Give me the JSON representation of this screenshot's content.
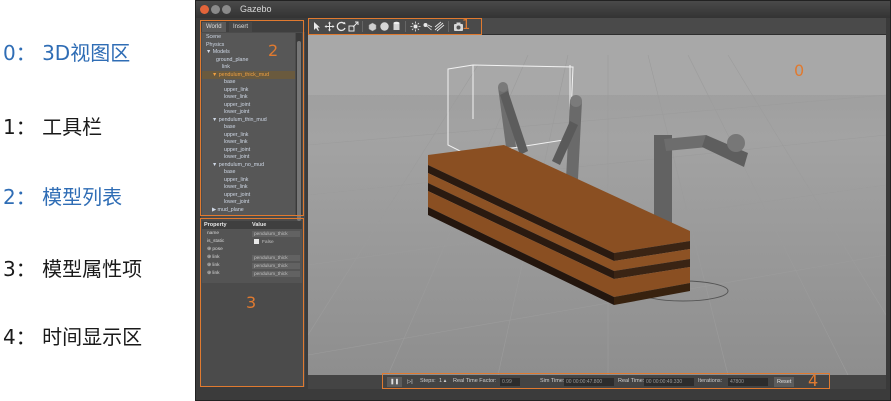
{
  "legend": [
    {
      "text": "0： 3D视图区",
      "color": "#2f6db5"
    },
    {
      "text": "1： 工具栏",
      "color": "#1a1a1a"
    },
    {
      "text": "2： 模型列表",
      "color": "#2f6db5"
    },
    {
      "text": "3： 模型属性项",
      "color": "#1a1a1a"
    },
    {
      "text": "4： 时间显示区",
      "color": "#1a1a1a"
    }
  ],
  "window": {
    "title": "Gazebo"
  },
  "left_panel": {
    "tabs": [
      "World",
      "Insert"
    ],
    "tree": [
      "Scene",
      "Physics",
      "▼ Models",
      "ground_plane",
      "link",
      "▼ pendulum_thick_mud",
      "base",
      "upper_link",
      "lower_link",
      "upper_joint",
      "lower_joint",
      "▼ pendulum_thin_mud",
      "base",
      "upper_link",
      "lower_link",
      "upper_joint",
      "lower_joint",
      "▼ pendulum_no_mud",
      "base",
      "upper_link",
      "lower_link",
      "upper_joint",
      "lower_joint",
      "▶ mud_plane"
    ],
    "selected_index": 5,
    "properties": {
      "header": [
        "Property",
        "Value"
      ],
      "rows": [
        {
          "key": "name",
          "value": "pendulum_thick"
        },
        {
          "key": "is_static",
          "value": "False"
        },
        {
          "key": "⊕ pose",
          "value": ""
        },
        {
          "key": "⊕ link",
          "value": "pendulum_thick"
        },
        {
          "key": "⊕ link",
          "value": "pendulum_thick"
        },
        {
          "key": "⊕ link",
          "value": "pendulum_thick"
        }
      ]
    }
  },
  "toolbar": {
    "icons": [
      "select-arrow-icon",
      "translate-icon",
      "rotate-icon",
      "scale-icon",
      "box-icon",
      "sphere-icon",
      "cylinder-icon",
      "point-light-icon",
      "spot-light-icon",
      "directional-light-icon",
      "screenshot-icon"
    ]
  },
  "timebar": {
    "pause_glyph": "❚❚",
    "step_glyph": "▷|",
    "steps_label": "Steps:",
    "steps_value": "1 ▴",
    "rtf_label": "Real Time Factor:",
    "rtf_value": "0.99",
    "sim_time_label": "Sim Time:",
    "sim_time_value": "00 00:00:47.800",
    "real_time_label": "Real Time:",
    "real_time_value": "00 00:00:49.330",
    "iterations_label": "Iterations:",
    "iterations_value": "47800",
    "reset_label": "Reset"
  },
  "annotations": {
    "color": "#e07a30",
    "labels": [
      "0",
      "1",
      "2",
      "3",
      "4"
    ]
  }
}
